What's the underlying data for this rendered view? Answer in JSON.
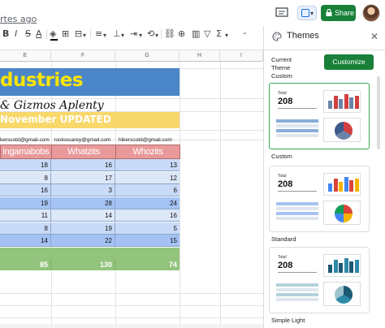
{
  "header": {
    "last_edit": "rtes ago",
    "share_label": "Share"
  },
  "toolbar": {
    "bold": "B",
    "italic": "I",
    "strike": "S",
    "font_color": "A",
    "fill": "◈",
    "borders": "⊞",
    "merge": "⊟",
    "halign": "≡",
    "valign": "⊥",
    "wrap": "⇥",
    "rotate": "⟲",
    "link": "⛓",
    "comment": "⊕",
    "chart": "▥",
    "filter": "▽",
    "functions": "Σ",
    "caret": "▾"
  },
  "grid": {
    "columns": [
      "E",
      "F",
      "G",
      "H",
      "I"
    ],
    "title": "dustries",
    "subtitle": "& Gizmos Aplenty",
    "date_line": "November UPDATED",
    "emails": [
      "kerscotd@gmail.com",
      "looloocarey@gmail.com",
      "hikerscotd@gmail.com"
    ],
    "headers": [
      "ingamabobs",
      "Whatzits",
      "Whozits"
    ],
    "rows": [
      [
        "18",
        "16",
        "13"
      ],
      [
        "8",
        "17",
        "12"
      ],
      [
        "16",
        "3",
        "6"
      ],
      [
        "19",
        "28",
        "24"
      ],
      [
        "11",
        "14",
        "16"
      ],
      [
        "8",
        "19",
        "5"
      ],
      [
        "14",
        "22",
        "15"
      ]
    ],
    "totals": [
      "85",
      "130",
      "74"
    ]
  },
  "panel": {
    "title": "Themes",
    "current_theme_label": "Current Theme\nCustom",
    "customize_label": "Customize",
    "themes": [
      {
        "name": "Custom",
        "total_label": "Total",
        "total_value": "208",
        "bars": [
          "#6b84a8",
          "#d13f3f",
          "#6b84a8",
          "#d13f3f",
          "#6b84a8",
          "#d13f3f"
        ],
        "pie": [
          "#d13f3f",
          "#6b84a8",
          "#3c5a8a"
        ],
        "band": "#8aaed8"
      },
      {
        "name": "Standard",
        "total_label": "Total",
        "total_value": "208",
        "bars": [
          "#4285f4",
          "#db4437",
          "#f4b400",
          "#4285f4",
          "#db4437",
          "#f4b400"
        ],
        "pie": [
          "#db4437",
          "#f4b400",
          "#4285f4",
          "#0f9d58"
        ],
        "band": "#a7c3f5"
      },
      {
        "name": "Simple Light",
        "total_label": "Total",
        "total_value": "208",
        "bars": [
          "#1c5a73",
          "#2d8aa8",
          "#1c5a73",
          "#2d8aa8",
          "#1c5a73",
          "#2d8aa8"
        ],
        "pie": [
          "#1c5a73",
          "#2d8aa8",
          "#9fc4d0"
        ],
        "band": "#b3d2dc"
      }
    ]
  }
}
